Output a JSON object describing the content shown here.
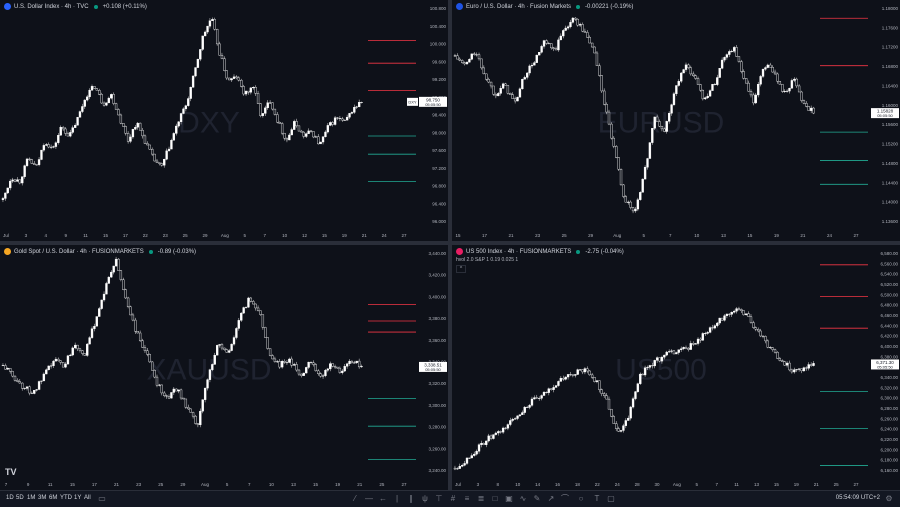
{
  "panes": [
    {
      "id": "dxy",
      "legend": "U.S. Dollar Index · 4h · TVC",
      "change": "+0.108 (+0.11%)",
      "watermark": "DXY",
      "icon_color": "#2962ff",
      "price_labels": [
        "100.800",
        "100.400",
        "100.000",
        "99.600",
        "99.200",
        "98.800",
        "98.400",
        "98.000",
        "97.600",
        "97.200",
        "96.800",
        "96.400",
        "96.000"
      ],
      "time_labels": [
        "Jul",
        "3",
        "4",
        "9",
        "11",
        "15",
        "17",
        "22",
        "23",
        "25",
        "29",
        "Aug",
        "5",
        "7",
        "10",
        "12",
        "15",
        "19",
        "21",
        "24",
        "27"
      ],
      "last_symbol": "DXY",
      "last_price": "98.750",
      "last_time": "05:05:50"
    },
    {
      "id": "eurusd",
      "legend": "Euro / U.S. Dollar · 4h · Fusion Markets",
      "change": "-0.00221 (-0.19%)",
      "watermark": "EURUSD",
      "icon_color": "#1e53e5",
      "price_labels": [
        "1.18000",
        "1.17600",
        "1.17200",
        "1.16800",
        "1.16400",
        "1.16000",
        "1.15600",
        "1.15200",
        "1.14800",
        "1.14400",
        "1.14000",
        "1.13600"
      ],
      "time_labels": [
        "15",
        "17",
        "21",
        "23",
        "25",
        "29",
        "Aug",
        "5",
        "7",
        "10",
        "13",
        "15",
        "19",
        "21",
        "24",
        "27"
      ],
      "last_price": "1.15828",
      "last_time": "05:05:50"
    },
    {
      "id": "xauusd",
      "legend": "Gold Spot / U.S. Dollar · 4h · FUSIONMARKETS",
      "change": "-0.89 (-0.03%)",
      "watermark": "XAUUSD",
      "icon_color": "#f5a623",
      "price_labels": [
        "3,440.00",
        "3,420.00",
        "3,400.00",
        "3,380.00",
        "3,360.00",
        "3,340.00",
        "3,320.00",
        "3,300.00",
        "3,280.00",
        "3,260.00",
        "3,240.00"
      ],
      "time_labels": [
        "7",
        "9",
        "11",
        "15",
        "17",
        "21",
        "23",
        "25",
        "29",
        "Aug",
        "5",
        "7",
        "10",
        "13",
        "15",
        "19",
        "21",
        "25",
        "27"
      ],
      "last_price": "3,338.51",
      "last_time": "05:05:50"
    },
    {
      "id": "us500",
      "legend": "US 500 Index · 4h · FUSIONMARKETS",
      "change": "-2.75 (-0.04%)",
      "watermark": "US500",
      "icon_color": "#e91e63",
      "indicator": "hvol 2.0 S&P 1 0.19 0.025 1",
      "price_labels": [
        "6,580.00",
        "6,560.00",
        "6,540.00",
        "6,520.00",
        "6,500.00",
        "6,480.00",
        "6,460.00",
        "6,440.00",
        "6,420.00",
        "6,400.00",
        "6,380.00",
        "6,360.00",
        "6,340.00",
        "6,320.00",
        "6,300.00",
        "6,280.00",
        "6,260.00",
        "6,240.00",
        "6,220.00",
        "6,200.00",
        "6,180.00",
        "6,160.00"
      ],
      "time_labels": [
        "Jul",
        "3",
        "8",
        "10",
        "14",
        "16",
        "18",
        "22",
        "24",
        "28",
        "30",
        "Aug",
        "5",
        "7",
        "11",
        "13",
        "15",
        "19",
        "21",
        "25",
        "27"
      ],
      "last_price": "6,371.30",
      "last_time": "05:05:50"
    }
  ],
  "chart_data": [
    {
      "type": "candlestick",
      "symbol": "DXY",
      "ylim": [
        96.0,
        100.9
      ],
      "close_path": [
        96.6,
        97.1,
        97.0,
        97.5,
        97.3,
        97.9,
        97.7,
        98.2,
        98.0,
        98.4,
        98.9,
        99.1,
        98.7,
        98.9,
        98.4,
        97.9,
        98.3,
        97.9,
        97.5,
        97.3,
        97.8,
        98.3,
        98.7,
        99.4,
        100.2,
        100.6,
        99.8,
        99.2,
        99.3,
        98.9,
        99.1,
        98.4,
        98.8,
        98.3,
        97.9,
        98.3,
        98.0,
        98.1,
        97.8,
        98.2,
        98.4,
        98.3,
        98.6,
        98.75
      ],
      "levels_red": [
        100.1,
        99.6,
        99.0
      ],
      "levels_green": [
        98.0,
        97.6,
        97.0
      ]
    },
    {
      "type": "candlestick",
      "symbol": "EURUSD",
      "ylim": [
        1.134,
        1.181
      ],
      "close_path": [
        1.17,
        1.168,
        1.171,
        1.166,
        1.162,
        1.164,
        1.16,
        1.166,
        1.169,
        1.173,
        1.171,
        1.176,
        1.178,
        1.175,
        1.171,
        1.16,
        1.15,
        1.14,
        1.137,
        1.145,
        1.157,
        1.154,
        1.162,
        1.168,
        1.166,
        1.161,
        1.164,
        1.17,
        1.172,
        1.165,
        1.16,
        1.168,
        1.167,
        1.162,
        1.165,
        1.16,
        1.158
      ],
      "levels_red": [
        1.178,
        1.168
      ],
      "levels_green": [
        1.154,
        1.148,
        1.143
      ]
    },
    {
      "type": "candlestick",
      "symbol": "XAUUSD",
      "ylim": [
        3240,
        3445
      ],
      "close_path": [
        3340,
        3330,
        3320,
        3315,
        3330,
        3345,
        3340,
        3360,
        3350,
        3380,
        3410,
        3435,
        3400,
        3370,
        3350,
        3325,
        3310,
        3320,
        3300,
        3285,
        3330,
        3360,
        3350,
        3380,
        3400,
        3390,
        3350,
        3340,
        3345,
        3330,
        3345,
        3330,
        3340,
        3335,
        3345,
        3338.5
      ],
      "levels_red": [
        3395,
        3380,
        3370
      ],
      "levels_green": [
        3310,
        3285,
        3255
      ]
    },
    {
      "type": "candlestick",
      "symbol": "US500",
      "ylim": [
        6160,
        6590
      ],
      "close_path": [
        6175,
        6190,
        6210,
        6230,
        6240,
        6260,
        6280,
        6300,
        6310,
        6330,
        6345,
        6355,
        6360,
        6340,
        6300,
        6240,
        6275,
        6350,
        6370,
        6385,
        6395,
        6400,
        6410,
        6430,
        6445,
        6470,
        6475,
        6460,
        6430,
        6400,
        6380,
        6360,
        6365,
        6371.3
      ],
      "levels_red": [
        6560,
        6500,
        6440
      ],
      "levels_green": [
        6320,
        6250,
        6180
      ]
    }
  ],
  "toolbar": {
    "timeframes": [
      "1D",
      "5D",
      "1M",
      "3M",
      "6M",
      "YTD",
      "1Y",
      "All"
    ],
    "clock": "05:54:09 UTC+2",
    "logo": "TV"
  }
}
